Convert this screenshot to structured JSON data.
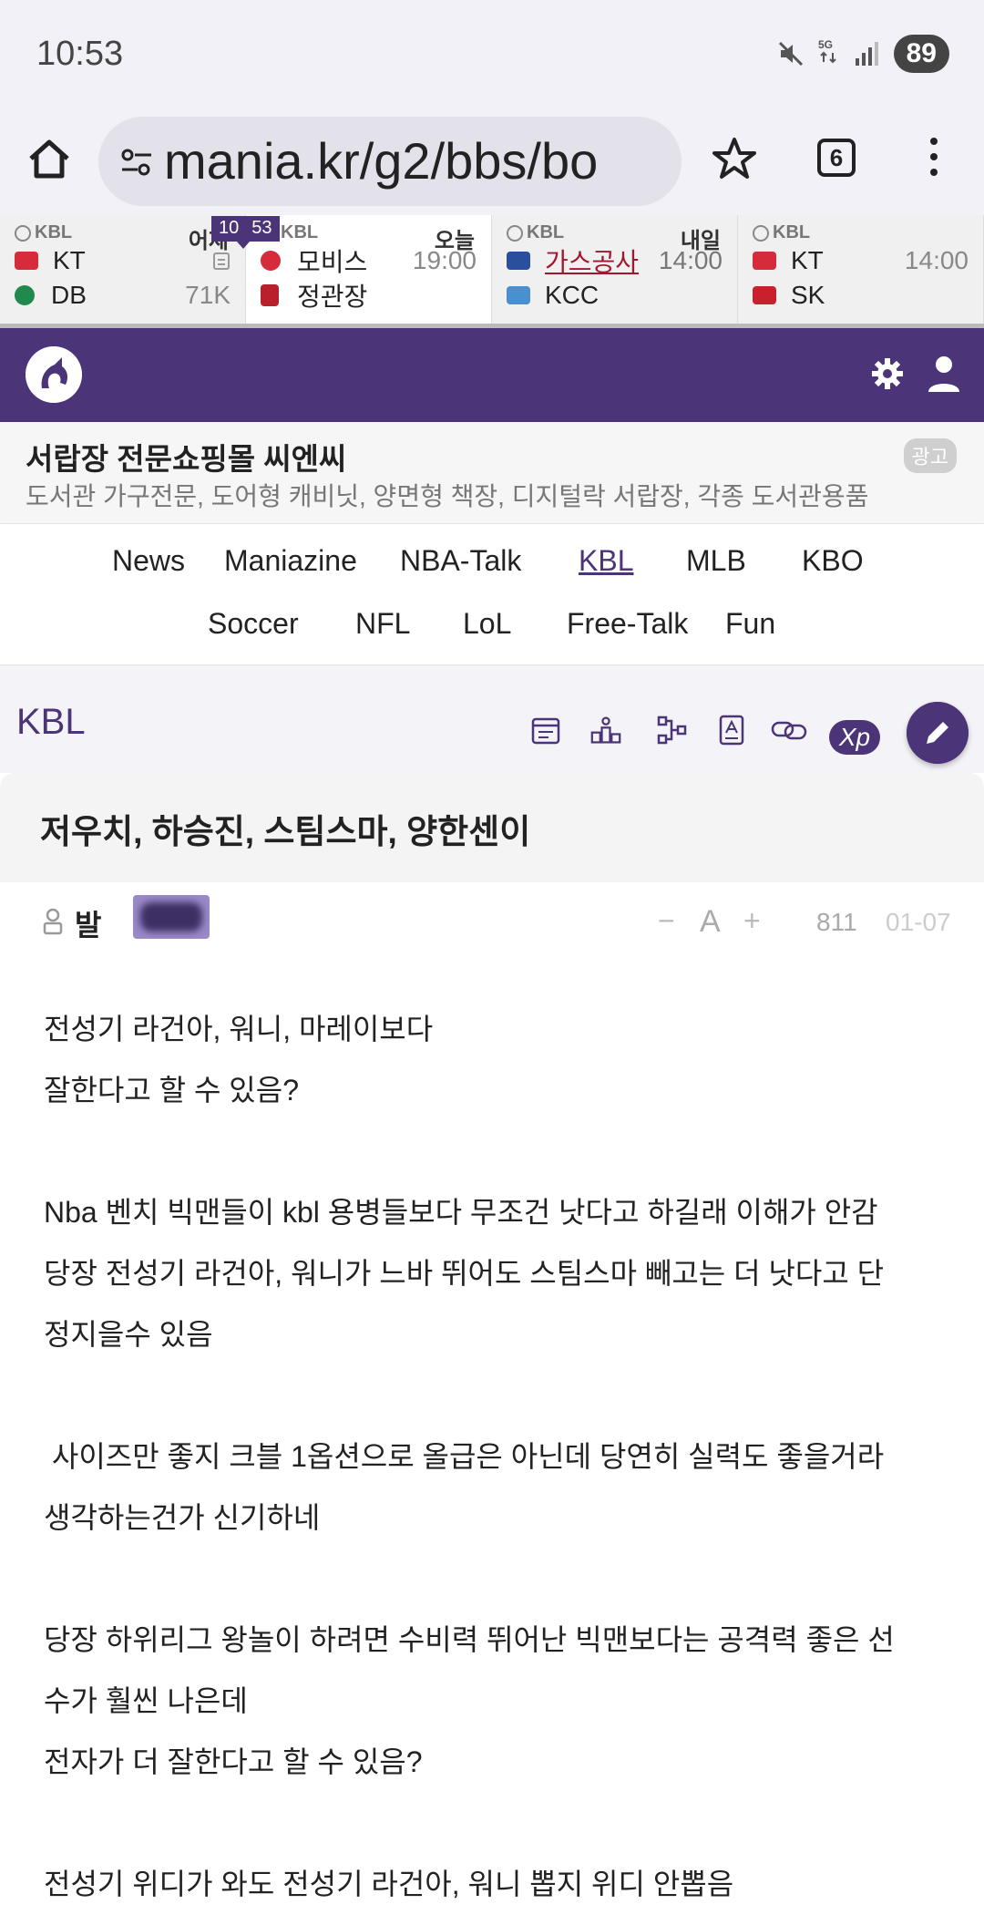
{
  "status": {
    "time": "10:53",
    "battery": "89"
  },
  "browser": {
    "url": "mania.kr/g2/bbs/bo",
    "tab_count": "6"
  },
  "scoreboard": {
    "notice": [
      "10",
      "53"
    ],
    "games": [
      {
        "league": "KBL",
        "when": "어제",
        "home": "KT",
        "away": "DB",
        "home_extra": "",
        "away_extra": "71K"
      },
      {
        "league": "KBL",
        "when": "오늘",
        "home": "모비스",
        "away": "정관장",
        "home_extra": "19:00",
        "away_extra": ""
      },
      {
        "league": "KBL",
        "when": "내일",
        "home": "가스공사",
        "away": "KCC",
        "home_extra": "14:00",
        "away_extra": ""
      },
      {
        "league": "KBL",
        "when": "",
        "home": "KT",
        "away": "SK",
        "home_extra": "14:00",
        "away_extra": ""
      }
    ]
  },
  "ad": {
    "title": "서랍장 전문쇼핑몰 씨엔씨",
    "desc": "도서관 가구전문, 도어형 캐비닛, 양면형 책장, 디지털락 서랍장, 각종 도서관용품",
    "badge": "광고"
  },
  "nav": {
    "items": [
      "News",
      "Maniazine",
      "NBA-Talk",
      "KBL",
      "MLB",
      "KBO",
      "Soccer",
      "NFL",
      "LoL",
      "Free-Talk",
      "Fun"
    ],
    "active": "KBL"
  },
  "board": {
    "title": "KBL",
    "xp_label": "Xp"
  },
  "post": {
    "title": "저우치, 하승진, 스팀스마, 양한센이",
    "author": "발",
    "font_minus": "−",
    "font_label": "A",
    "font_plus": "+",
    "views": "811",
    "date": "01-07",
    "lines": [
      "전성기 라건아, 워니, 마레이보다",
      "잘한다고 할 수 있음?",
      "",
      "Nba 벤치 빅맨들이 kbl 용병들보다 무조건 낫다고 하길래 이해가 안감",
      "당장 전성기 라건아, 워니가 느바 뛰어도 스팀스마 빼고는 더 낫다고 단",
      "정지을수 있음",
      "",
      " 사이즈만 좋지 크블 1옵션으로 올급은 아닌데 당연히 실력도 좋을거라",
      "생각하는건가 신기하네",
      "",
      "당장 하위리그 왕놀이 하려면 수비력 뛰어난 빅맨보다는 공격력 좋은 선",
      "수가 훨씬 나은데",
      "전자가 더 잘한다고 할 수 있음?",
      "",
      "전성기 위디가 와도 전성기 라건아, 워니 뽑지 위디 안뽑음"
    ]
  },
  "colors": {
    "brand": "#4b3477",
    "highlight": "#a0182e"
  }
}
